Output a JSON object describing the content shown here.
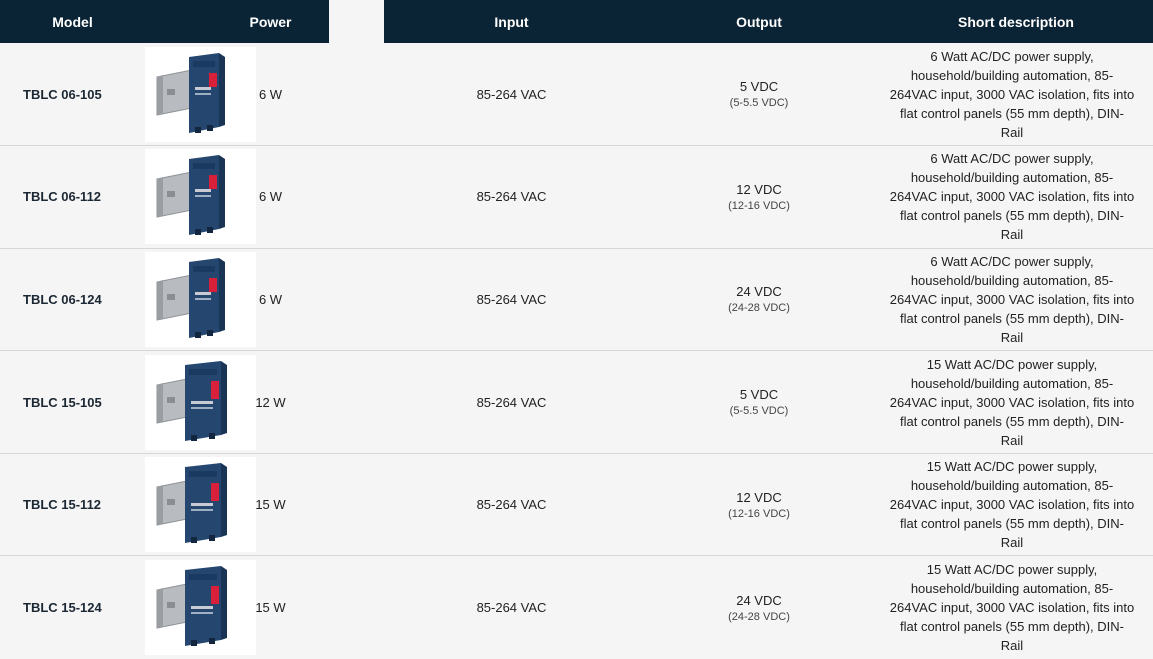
{
  "table": {
    "headers": [
      "Model",
      "",
      "Power",
      "Input",
      "Output",
      "Short description"
    ],
    "rows": [
      {
        "model": "TBLC 06-105",
        "power": "6 W",
        "input": "85-264 VAC",
        "output_main": "5 VDC",
        "output_sub": "(5-5.5 VDC)",
        "description": "6 Watt AC/DC power supply, household/building automation, 85-264VAC input, 3000 VAC isolation, fits into flat control panels (55 mm depth), DIN-Rail",
        "image": "din-rail-power-supply-small-icon"
      },
      {
        "model": "TBLC 06-112",
        "power": "6 W",
        "input": "85-264 VAC",
        "output_main": "12 VDC",
        "output_sub": "(12-16 VDC)",
        "description": "6 Watt AC/DC power supply, household/building automation, 85-264VAC input, 3000 VAC isolation, fits into flat control panels (55 mm depth), DIN-Rail",
        "image": "din-rail-power-supply-small-icon"
      },
      {
        "model": "TBLC 06-124",
        "power": "6 W",
        "input": "85-264 VAC",
        "output_main": "24 VDC",
        "output_sub": "(24-28 VDC)",
        "description": "6 Watt AC/DC power supply, household/building automation, 85-264VAC input, 3000 VAC isolation, fits into flat control panels (55 mm depth), DIN-Rail",
        "image": "din-rail-power-supply-small-icon"
      },
      {
        "model": "TBLC 15-105",
        "power": "12 W",
        "input": "85-264 VAC",
        "output_main": "5 VDC",
        "output_sub": "(5-5.5 VDC)",
        "description": "15 Watt AC/DC power supply, household/building automation, 85-264VAC input, 3000 VAC isolation, fits into flat control panels (55 mm depth), DIN-Rail",
        "image": "din-rail-power-supply-large-icon"
      },
      {
        "model": "TBLC 15-112",
        "power": "15 W",
        "input": "85-264 VAC",
        "output_main": "12 VDC",
        "output_sub": "(12-16 VDC)",
        "description": "15 Watt AC/DC power supply, household/building automation, 85-264VAC input, 3000 VAC isolation, fits into flat control panels (55 mm depth), DIN-Rail",
        "image": "din-rail-power-supply-large-icon"
      },
      {
        "model": "TBLC 15-124",
        "power": "15 W",
        "input": "85-264 VAC",
        "output_main": "24 VDC",
        "output_sub": "(24-28 VDC)",
        "description": "15 Watt AC/DC power supply, household/building automation, 85-264VAC input, 3000 VAC isolation, fits into flat control panels (55 mm depth), DIN-Rail",
        "image": "din-rail-power-supply-large-icon"
      }
    ]
  },
  "colors": {
    "header_bg": "#0b2435",
    "row_bg": "#f5f5f5",
    "device_blue": "#24466f",
    "device_label_red": "#d8203a",
    "rail_silver": "#b8bcc0"
  }
}
